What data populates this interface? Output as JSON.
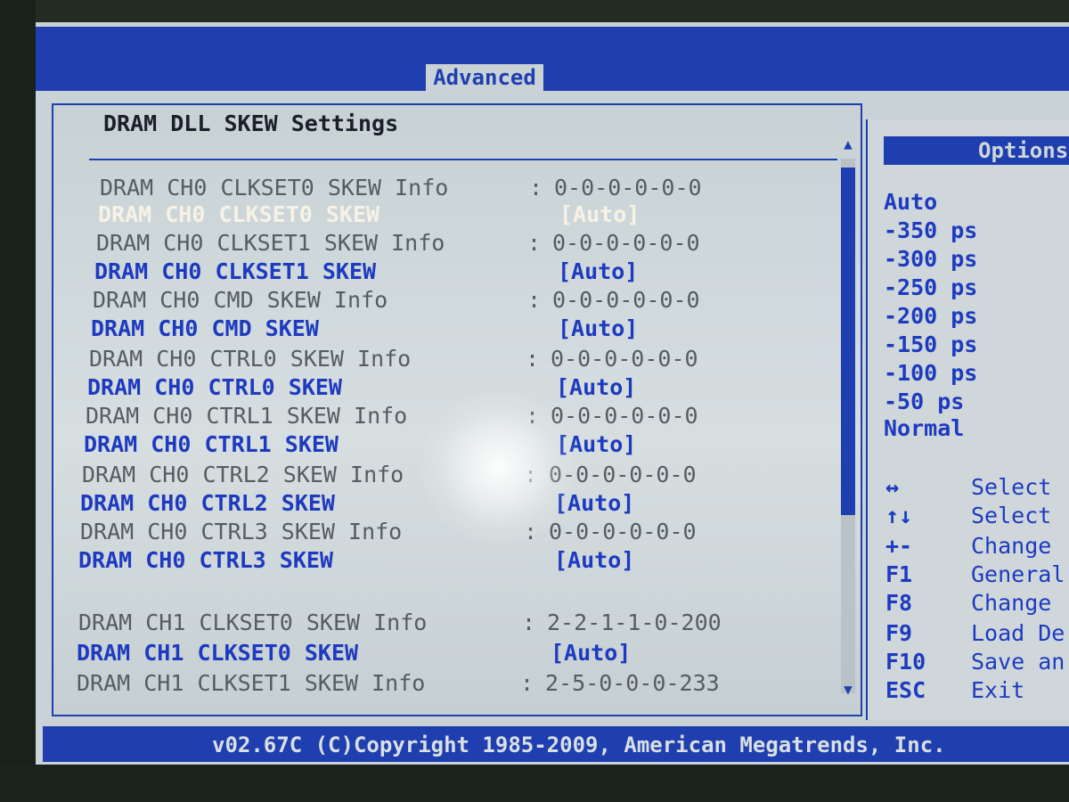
{
  "tabs": {
    "active": "Advanced"
  },
  "panel": {
    "title": "DRAM DLL SKEW Settings"
  },
  "rows": [
    {
      "label": "DRAM CH0 CLKSET0 SKEW Info",
      "value": "0-0-0-0-0-0",
      "kind": "info"
    },
    {
      "label": "DRAM CH0 CLKSET0 SKEW",
      "value": "[Auto]",
      "kind": "selected"
    },
    {
      "label": "DRAM CH0 CLKSET1 SKEW Info",
      "value": "0-0-0-0-0-0",
      "kind": "info"
    },
    {
      "label": "DRAM CH0 CLKSET1 SKEW",
      "value": "[Auto]",
      "kind": "setting"
    },
    {
      "label": "DRAM CH0 CMD SKEW Info",
      "value": "0-0-0-0-0-0",
      "kind": "info"
    },
    {
      "label": "DRAM CH0 CMD SKEW",
      "value": "[Auto]",
      "kind": "setting"
    },
    {
      "label": "DRAM CH0 CTRL0 SKEW Info",
      "value": "0-0-0-0-0-0",
      "kind": "info"
    },
    {
      "label": "DRAM CH0 CTRL0 SKEW",
      "value": "[Auto]",
      "kind": "setting"
    },
    {
      "label": "DRAM CH0 CTRL1 SKEW Info",
      "value": "0-0-0-0-0-0",
      "kind": "info"
    },
    {
      "label": "DRAM CH0 CTRL1 SKEW",
      "value": "[Auto]",
      "kind": "setting"
    },
    {
      "label": "DRAM CH0 CTRL2 SKEW Info",
      "value": "0-0-0-0-0-0",
      "kind": "info"
    },
    {
      "label": "DRAM CH0 CTRL2 SKEW",
      "value": "[Auto]",
      "kind": "setting"
    },
    {
      "label": "DRAM CH0 CTRL3 SKEW Info",
      "value": "0-0-0-0-0-0",
      "kind": "info"
    },
    {
      "label": "DRAM CH0 CTRL3 SKEW",
      "value": "[Auto]",
      "kind": "setting"
    },
    {
      "label": "DRAM CH1 CLKSET0 SKEW Info",
      "value": "2-2-1-1-0-200",
      "kind": "info"
    },
    {
      "label": "DRAM CH1 CLKSET0 SKEW",
      "value": "[Auto]",
      "kind": "setting"
    },
    {
      "label": "DRAM CH1 CLKSET1 SKEW Info",
      "value": "2-5-0-0-0-233",
      "kind": "info"
    }
  ],
  "options": {
    "title": "Options",
    "items": [
      "Auto",
      "-350 ps",
      "-300 ps",
      "-250 ps",
      "-200 ps",
      "-150 ps",
      "-100 ps",
      "-50 ps",
      "Normal"
    ]
  },
  "help": [
    {
      "key": "↔",
      "desc": "Select"
    },
    {
      "key": "↑↓",
      "desc": "Select"
    },
    {
      "key": "+-",
      "desc": "Change"
    },
    {
      "key": "F1",
      "desc": "General"
    },
    {
      "key": "F8",
      "desc": "Change"
    },
    {
      "key": "F9",
      "desc": "Load De"
    },
    {
      "key": "F10",
      "desc": "Save an"
    },
    {
      "key": "ESC",
      "desc": "Exit"
    }
  ],
  "footer": {
    "text": "v02.67C (C)Copyright 1985-2009, American Megatrends, Inc."
  },
  "colors": {
    "bios_blue": "#1f3fb0",
    "panel_bg": "#c9d2d6",
    "info_text": "#555d62",
    "selected_text": "#f7f2e6"
  },
  "scrollbar": {
    "up_icon": "▲",
    "down_icon": "▼"
  }
}
